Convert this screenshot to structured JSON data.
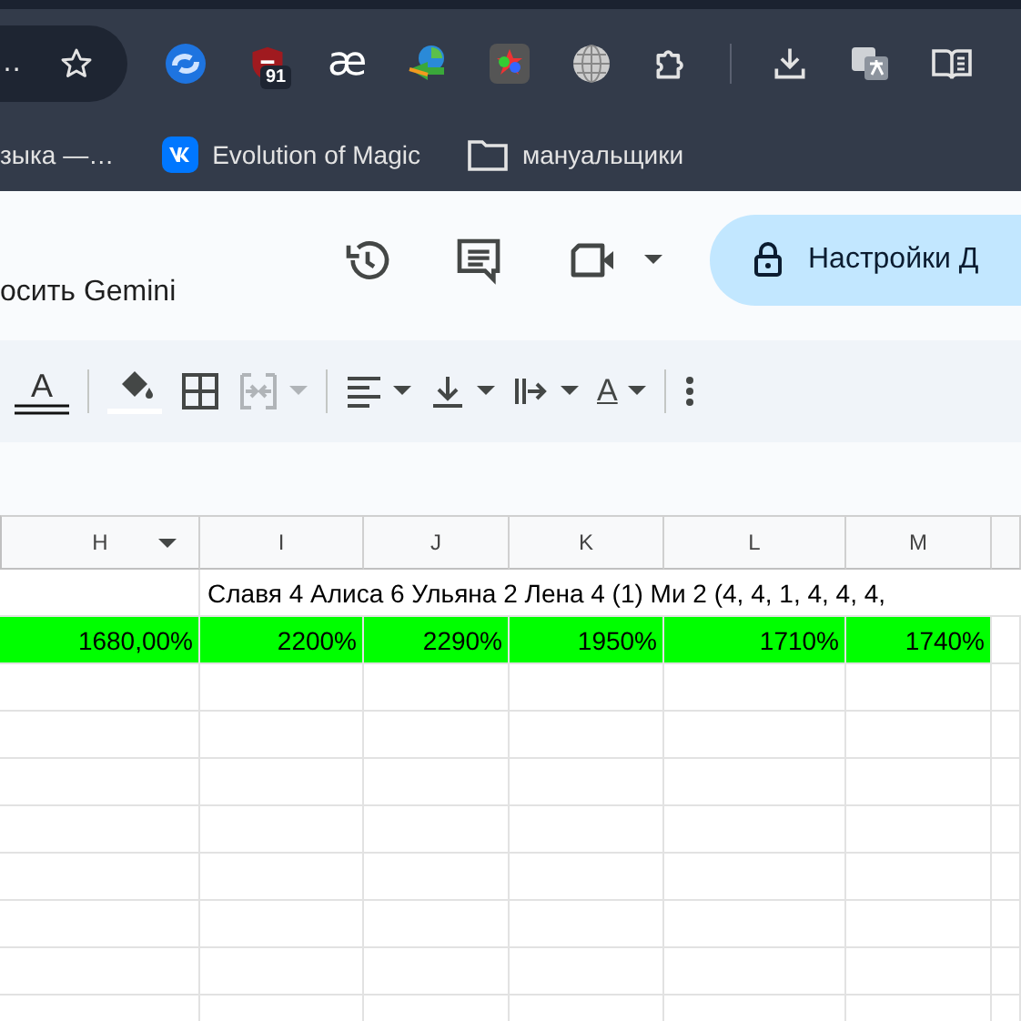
{
  "browser": {
    "address_text": "…",
    "extension_badge": "91",
    "extension_glyph": "æ",
    "bookmarks": [
      {
        "label": "зыка —…",
        "kind": "plain"
      },
      {
        "label": "Evolution of Magic",
        "kind": "site"
      },
      {
        "label": "мануальщики",
        "kind": "folder"
      }
    ]
  },
  "docs": {
    "gemini_text": "осить Gemini",
    "share_button": "Настройки Д"
  },
  "toolbar": {
    "text_color_glyph": "A",
    "rotation_glyph": "A",
    "merge_disabled": true
  },
  "sheet": {
    "columns": [
      {
        "label": "H",
        "filter": true
      },
      {
        "label": "I",
        "filter": false
      },
      {
        "label": "J",
        "filter": false
      },
      {
        "label": "K",
        "filter": false
      },
      {
        "label": "L",
        "filter": false
      },
      {
        "label": "M",
        "filter": false
      }
    ],
    "rows": [
      {
        "kind": "note",
        "cells": [
          "",
          "Славя 4 Алиса 6 Ульяна 2 Лена 4 (1) Ми 2 (4, 4, 1, 4, 4, 4,"
        ]
      },
      {
        "kind": "values",
        "cells": [
          "1680,00%",
          "2200%",
          "2290%",
          "1950%",
          "1710%",
          "1740%"
        ],
        "color": "#00ff00"
      }
    ]
  }
}
